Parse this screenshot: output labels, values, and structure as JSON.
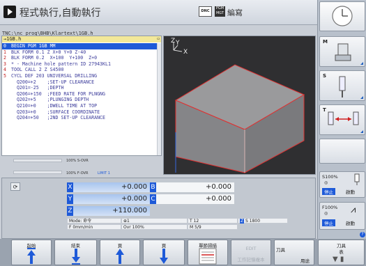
{
  "header": {
    "mode_title": "程式執行,自動執行",
    "dnc_badge": "DNC",
    "pgm_badge_line1": "PGM",
    "pgm_badge_line2": "MGT",
    "edit_label": "編寫"
  },
  "program": {
    "path": "TNC:\\nc_prog\\BHB\\Klartext\\1GB.h",
    "file_tab": "→1GB.h",
    "lines": [
      {
        "num": "0",
        "text": "BEGIN PGM 1GB MM"
      },
      {
        "num": "1",
        "text": "BLK FORM 0.1 Z X+0 Y+0 Z-40"
      },
      {
        "num": "2",
        "text": "BLK FORM 0.2  X+100  Y+100  Z+0"
      },
      {
        "num": "3",
        "text": "* - Machine hole pattern ID 27943KL1"
      },
      {
        "num": "4",
        "text": "TOOL CALL 2 Z S4500"
      },
      {
        "num": "5",
        "text": "CYCL DEF 203 UNIVERSAL DRILLING"
      },
      {
        "num": "",
        "text": "  Q200=+2    ;SET-UP CLEARANCE"
      },
      {
        "num": "",
        "text": "  Q201=-25   ;DEPTH"
      },
      {
        "num": "",
        "text": "  Q206=+150  ;FEED RATE FOR PLNGNG"
      },
      {
        "num": "",
        "text": "  Q202=+5    ;PLUNGING DEPTH"
      },
      {
        "num": "",
        "text": "  Q210=+0    ;DWELL TIME AT TOP"
      },
      {
        "num": "",
        "text": "  Q203=+0    ;SURFACE COORDINATE"
      },
      {
        "num": "",
        "text": "  Q204=+50   ;2ND SET-UP CLEARANCE"
      }
    ]
  },
  "view3d": {
    "axis_y": "Y",
    "axis_z": "Z",
    "axis_x": "X"
  },
  "overrides": {
    "s_ovr": "100% S-OVR",
    "f_ovr": "100% F-OVR",
    "limit": "LIMIT 1"
  },
  "positions": {
    "x_label": "X",
    "x_value": "+0.000",
    "y_label": "Y",
    "y_value": "+0.000",
    "z_label": "Z",
    "z_value": "+110.000",
    "b_label": "B",
    "b_value": "+0.000",
    "c_label": "C",
    "c_value": "+0.000"
  },
  "status": {
    "mode": "Mode: 命令",
    "f_rate": "F 0mm/min",
    "ovr": "Ovr 100%",
    "spindle_icon": "⊕1",
    "tool": "T 12",
    "spindle_axis": "Z",
    "speed": "S 1800",
    "m_func": "M 5/9"
  },
  "right_bar": {
    "m_label": "M",
    "s_label": "S",
    "t_label": "T",
    "s_ovr_pct": "S100%",
    "s_stop": "停止",
    "s_start": "啟動",
    "f_ovr_pct": "F100%",
    "f_stop": "停止",
    "f_start": "啟動"
  },
  "softkeys": {
    "start": "起始",
    "end": "結束",
    "page_up": "頁",
    "page_down": "頁",
    "single_block": "單節掃描",
    "edit": "EDIT",
    "edit_sub": "工作記憶複本",
    "tools": "刀具",
    "use": "用途",
    "tools2": "刀具",
    "table": "表"
  },
  "colors": {
    "accent": "#1e5ad8",
    "highlight": "#f2e899"
  }
}
